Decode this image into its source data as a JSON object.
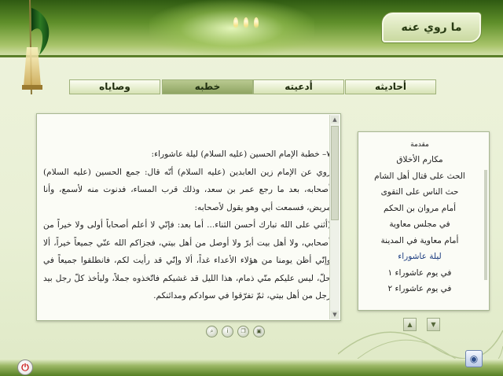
{
  "header": {
    "title": "ما روي عنه"
  },
  "tabs": [
    {
      "label": "أحاديثه",
      "active": false
    },
    {
      "label": "أدعيته",
      "active": false
    },
    {
      "label": "خطبه",
      "active": true
    },
    {
      "label": "وصاياه",
      "active": false
    }
  ],
  "content": {
    "paragraphs": [
      "٧– خطبة الإمام الحسين (عليه السلام) ليلة عاشوراء:",
      "روي عن الإمام زين العابدين (عليه السلام) أنّه قال: جمع الحسين (عليه السلام) أصحابه، بعد ما رجع عمر بن سعد، وذلك قرب المساء، فدنوت منه لأسمع، وأنا مريض، فسمعت أبي وهو يقول لأصحابه:",
      "(أثني على الله تبارك أحسن الثناء... أما بعد: فإنّي لا أعلم أصحاباً أولى ولا خيراً من أصحابي، ولا أهل بيت أبرّ ولا أوصل من أهل بيتي، فجزاكم الله عنّي جميعاً خيراً، ألا وإنّي أظن يومنا من هؤلاء الأعداء غداً، ألا وإنّي قد رأيت لكم، فانطلقوا جميعاً في حلّ، ليس عليكم منّي ذمام، هذا الليل قد غشيكم فاتّخذوه جملاً، وليأخذ كلّ رجل بيد رجل من أهل بيتي، ثمّ تفرّقوا في سوادكم ومدائنكم."
    ]
  },
  "list": {
    "items": [
      {
        "label": "مقدمة",
        "active": false
      },
      {
        "label": "مكارم الأخلاق",
        "active": false
      },
      {
        "label": "الحث على قتال أهل الشام",
        "active": false
      },
      {
        "label": "حث الناس على التقوى",
        "active": false
      },
      {
        "label": "أمام مروان بن الحكم",
        "active": false
      },
      {
        "label": "في مجلس معاوية",
        "active": false
      },
      {
        "label": "أمام معاوية في المدينة",
        "active": false
      },
      {
        "label": "ليلة عاشوراء",
        "active": true
      },
      {
        "label": "في يوم عاشوراء ١",
        "active": false
      },
      {
        "label": "في يوم عاشوراء ٢",
        "active": false
      }
    ]
  },
  "icons": {
    "nav_up": "chevron-up-icon",
    "nav_down": "chevron-down-icon",
    "exit": "power-icon",
    "corner": "app-icon",
    "tools": [
      "zoom-icon",
      "info-icon",
      "copy-icon",
      "save-icon"
    ]
  },
  "colors": {
    "active_list_item": "#1d3d80",
    "header_green": "#5f8f2a",
    "exit_red": "#cc1e1e"
  }
}
